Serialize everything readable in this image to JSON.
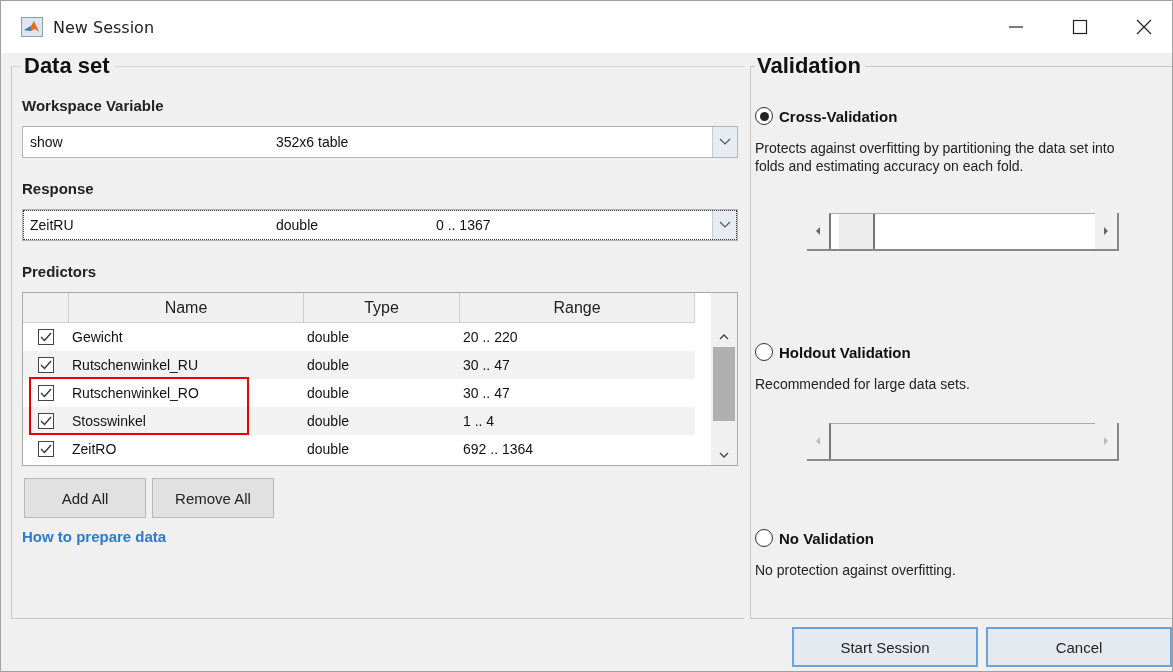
{
  "window": {
    "title": "New Session"
  },
  "data_set": {
    "title": "Data set",
    "workspace_variable": {
      "label": "Workspace Variable",
      "value": {
        "name": "show",
        "info": "352x6 table"
      }
    },
    "response": {
      "label": "Response",
      "value": {
        "name": "ZeitRU",
        "type": "double",
        "range": "0 .. 1367"
      }
    },
    "predictors": {
      "label": "Predictors",
      "columns": [
        "Name",
        "Type",
        "Range"
      ],
      "rows": [
        {
          "checked": true,
          "name": "Gewicht",
          "type": "double",
          "range": "20 .. 220",
          "highlighted": false
        },
        {
          "checked": true,
          "name": "Rutschenwinkel_RU",
          "type": "double",
          "range": "30 .. 47",
          "highlighted": false
        },
        {
          "checked": true,
          "name": "Rutschenwinkel_RO",
          "type": "double",
          "range": "30 .. 47",
          "highlighted": true
        },
        {
          "checked": true,
          "name": "Stosswinkel",
          "type": "double",
          "range": "1 .. 4",
          "highlighted": true
        },
        {
          "checked": true,
          "name": "ZeitRO",
          "type": "double",
          "range": "692 .. 1364",
          "highlighted": false
        }
      ]
    },
    "buttons": [
      "Add All",
      "Remove All"
    ],
    "link": "How to prepare data"
  },
  "validation": {
    "title": "Validation",
    "options": [
      {
        "label": "Cross-Validation",
        "selected": true,
        "description": "Protects against overfitting by partitioning the data set into folds and estimating accuracy on each fold.",
        "slider": {
          "disabled": false,
          "level": 0.03
        }
      },
      {
        "label": "Holdout Validation",
        "selected": false,
        "description": "Recommended for large data sets.",
        "slider": {
          "disabled": true
        }
      },
      {
        "label": "No Validation",
        "selected": false,
        "description": "No protection against overfitting."
      }
    ]
  },
  "buttons": [
    "Start Session",
    "Cancel"
  ]
}
